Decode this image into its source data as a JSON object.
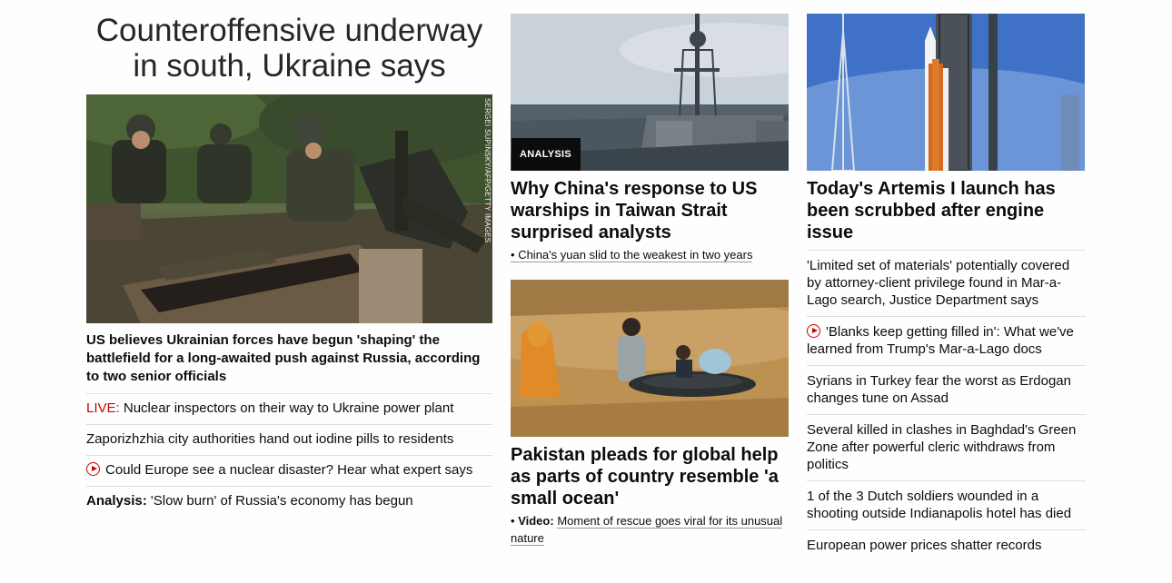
{
  "col1": {
    "headline": "Counteroffensive underway in south, Ukraine says",
    "image_credit": "SERGEI SUPINSKY/AFP/GETTY IMAGES",
    "story": "US believes Ukrainian forces have begun 'shaping' the battlefield for a long-awaited push against Russia, according to two senior officials",
    "links": {
      "live_prefix": "LIVE:",
      "item1": "Nuclear inspectors on their way to Ukraine power plant",
      "item2": "Zaporizhzhia city authorities hand out iodine pills to residents",
      "item3": "Could Europe see a nuclear disaster? Hear what expert says",
      "analysis_prefix": "Analysis:",
      "item4": "'Slow burn' of Russia's economy has begun"
    }
  },
  "col2": {
    "card1": {
      "badge": "ANALYSIS",
      "headline": "Why China's response to US warships in Taiwan Strait surprised analysts",
      "sub_bullet": "•",
      "sub": "China's yuan slid to the weakest in two years"
    },
    "card2": {
      "headline": "Pakistan pleads for global help as parts of country resemble 'a small ocean'",
      "sub_bullet": "•",
      "sub_prefix": "Video:",
      "sub": "Moment of rescue goes viral for its unusual nature"
    }
  },
  "col3": {
    "headline": "Today's Artemis I launch has been scrubbed after engine issue",
    "links": [
      "'Limited set of materials' potentially covered by attorney-client privilege found in Mar-a-Lago search, Justice Department says",
      "'Blanks keep getting filled in': What we've learned from Trump's Mar-a-Lago docs",
      "Syrians in Turkey fear the worst as Erdogan changes tune on Assad",
      "Several killed in clashes in Baghdad's Green Zone after powerful cleric withdraws from politics",
      "1 of the 3 Dutch soldiers wounded in a shooting outside Indianapolis hotel has died",
      "European power prices shatter records"
    ]
  },
  "icons": {
    "video": "play-circle-icon"
  },
  "colors": {
    "live_red": "#cc0000",
    "text": "#0c0c0c",
    "divider": "#dedede",
    "badge_bg": "#0c0c0c"
  }
}
